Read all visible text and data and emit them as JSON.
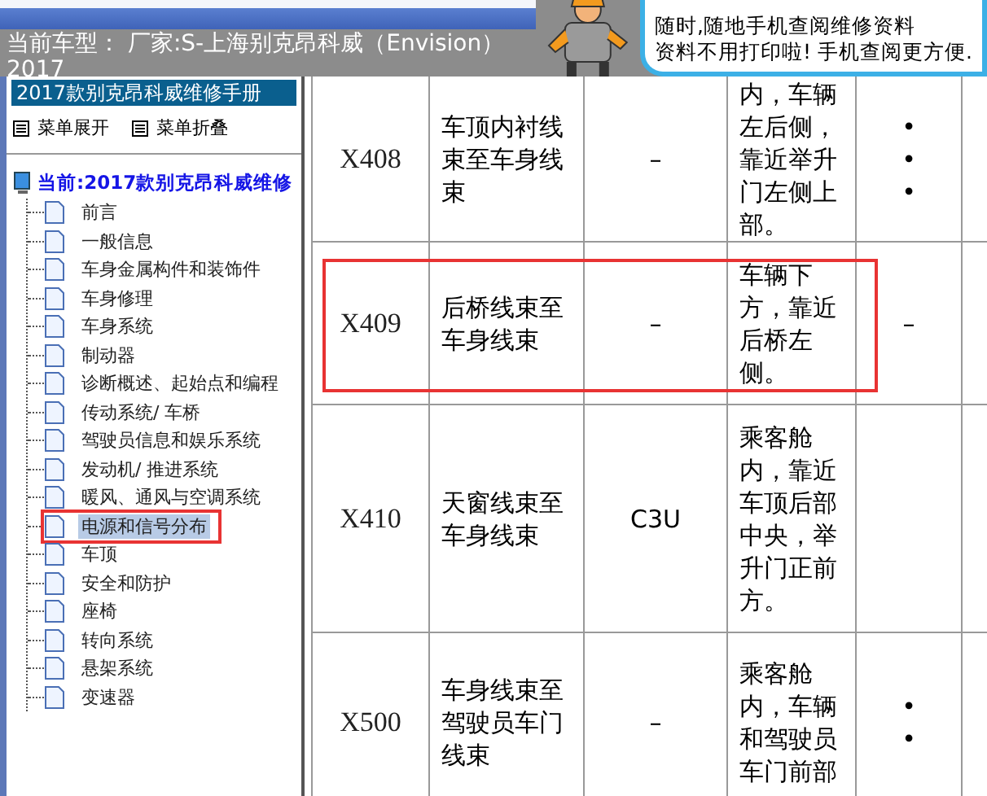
{
  "header": {
    "vehicle": "当前车型： 厂家:S-上海别克昂科威（Envision）2017",
    "banner_lines": [
      "随时,随地手机查阅维修资料",
      "资料不用打印啦! 手机查阅更方便."
    ]
  },
  "sidebar": {
    "title": "2017款别克昂科威维修手册",
    "actions": [
      "菜单展开",
      "菜单折叠"
    ],
    "root": "当前:2017款别克昂科威维修",
    "items": [
      {
        "label": "前言",
        "selected": false,
        "highlighted": false
      },
      {
        "label": "一般信息",
        "selected": false,
        "highlighted": false
      },
      {
        "label": "车身金属构件和装饰件",
        "selected": false,
        "highlighted": false
      },
      {
        "label": "车身修理",
        "selected": false,
        "highlighted": false
      },
      {
        "label": "车身系统",
        "selected": false,
        "highlighted": false
      },
      {
        "label": "制动器",
        "selected": false,
        "highlighted": false
      },
      {
        "label": "诊断概述、起始点和编程",
        "selected": false,
        "highlighted": false
      },
      {
        "label": "传动系统/ 车桥",
        "selected": false,
        "highlighted": false
      },
      {
        "label": "驾驶员信息和娱乐系统",
        "selected": false,
        "highlighted": false
      },
      {
        "label": "发动机/ 推进系统",
        "selected": false,
        "highlighted": false
      },
      {
        "label": "暖风、通风与空调系统",
        "selected": false,
        "highlighted": false
      },
      {
        "label": "电源和信号分布",
        "selected": true,
        "highlighted": true
      },
      {
        "label": "车顶",
        "selected": false,
        "highlighted": false
      },
      {
        "label": "安全和防护",
        "selected": false,
        "highlighted": false
      },
      {
        "label": "座椅",
        "selected": false,
        "highlighted": false
      },
      {
        "label": "转向系统",
        "selected": false,
        "highlighted": false
      },
      {
        "label": "悬架系统",
        "selected": false,
        "highlighted": false
      },
      {
        "label": "变速器",
        "selected": false,
        "highlighted": false
      }
    ]
  },
  "table": {
    "rows": [
      {
        "code": "X408",
        "name": "车顶内衬线束至车身线束",
        "connector": "–",
        "location": "内，车辆左后侧，靠近举升门左侧上部。",
        "column_5": [
          "•",
          "•",
          "•"
        ],
        "highlighted": false
      },
      {
        "code": "X409",
        "name": "后桥线束至车身线束",
        "connector": "–",
        "location": "车辆下方，靠近后桥左侧。",
        "column_5": [
          "–"
        ],
        "highlighted": true
      },
      {
        "code": "X410",
        "name": "天窗线束至车身线束",
        "connector": "C3U",
        "location": "乘客舱内，靠近车顶后部中央，举升门正前方。",
        "column_5": [],
        "highlighted": false
      },
      {
        "code": "X500",
        "name": "车身线束至驾驶员车门线束",
        "connector": "–",
        "location": "乘客舱内，车辆和驾驶员车门前部",
        "column_5": [
          "•",
          "•"
        ],
        "highlighted": false
      }
    ]
  }
}
